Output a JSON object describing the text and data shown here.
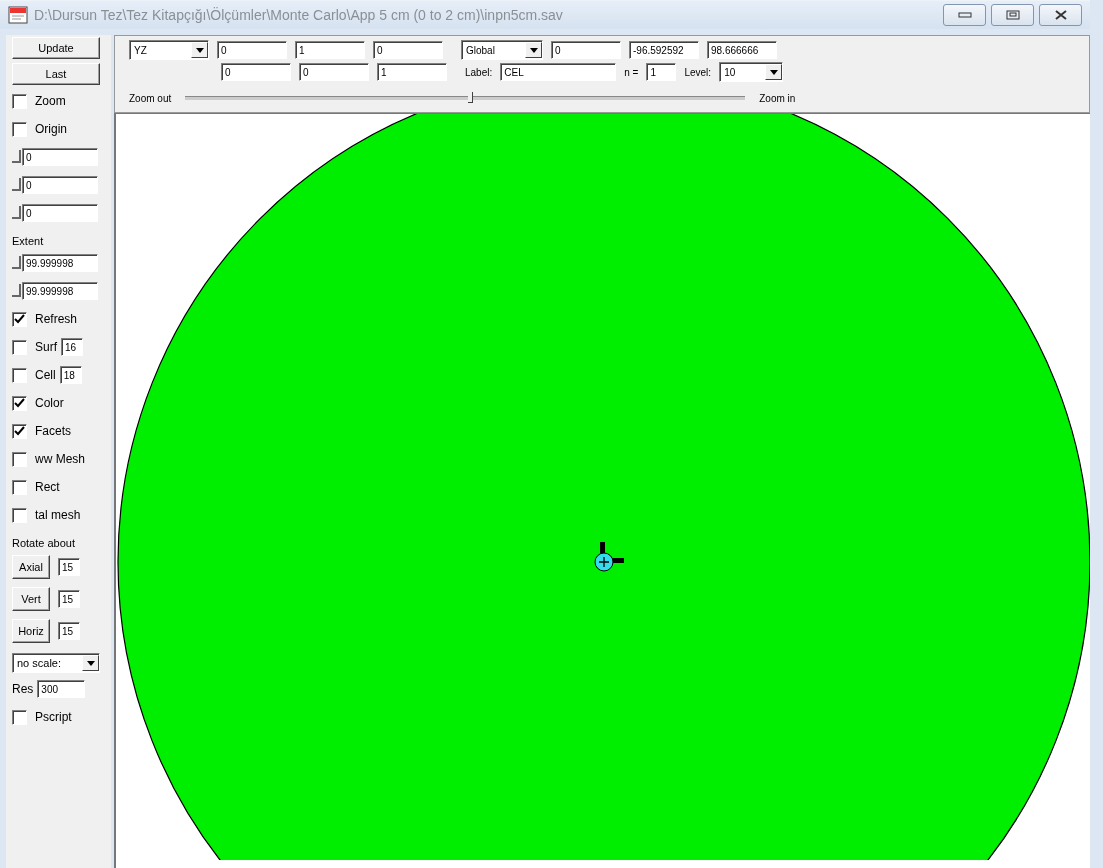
{
  "window": {
    "title": "D:\\Dursun Tez\\Tez Kitapçığı\\Ölçümler\\Monte Carlo\\App 5 cm (0 to 2 cm)\\inpn5cm.sav"
  },
  "toolbar": {
    "view_select": "YZ",
    "row1_fields": [
      "0",
      "1",
      "0"
    ],
    "row2_fields": [
      "0",
      "0",
      "1"
    ],
    "frame_select": "Global",
    "offset_fields": [
      "0",
      "-96.592592",
      "98.666666"
    ],
    "label_caption": "Label:",
    "label_value": "CEL",
    "n_caption": "n =",
    "n_value": "1",
    "level_caption": "Level:",
    "level_select": "10",
    "zoom_out": "Zoom out",
    "zoom_in": "Zoom in",
    "zoom": {
      "level": 0.505
    }
  },
  "sidebar": {
    "items": [
      {
        "kind": "button",
        "label": "Update"
      },
      {
        "kind": "button",
        "label": "Last"
      },
      {
        "kind": "checkbox",
        "label": "Zoom",
        "checked": false
      },
      {
        "kind": "checkbox",
        "label": "Origin",
        "checked": false
      },
      {
        "kind": "slider-field",
        "value": "0"
      },
      {
        "kind": "slider-field",
        "value": "0"
      },
      {
        "kind": "slider-field",
        "value": "0"
      },
      {
        "kind": "label",
        "label": "Extent"
      },
      {
        "kind": "slider-field",
        "value": "99.999998"
      },
      {
        "kind": "slider-field",
        "value": "99.999998"
      },
      {
        "kind": "checkbox",
        "label": "Refresh",
        "checked": true
      },
      {
        "kind": "checkbox-field",
        "label": "Surf",
        "checked": false,
        "value": "16"
      },
      {
        "kind": "checkbox-field",
        "label": "Cell",
        "checked": false,
        "value": "18"
      },
      {
        "kind": "checkbox",
        "label": "Color",
        "checked": true
      },
      {
        "kind": "checkbox",
        "label": "Facets",
        "checked": true
      },
      {
        "kind": "checkbox",
        "label": "ww Mesh",
        "checked": false
      },
      {
        "kind": "checkbox",
        "label": "Rect",
        "checked": false
      },
      {
        "kind": "checkbox",
        "label": "tal mesh",
        "checked": false
      },
      {
        "kind": "label",
        "label": "Rotate about"
      },
      {
        "kind": "button-field",
        "label": "Axial",
        "value": "15"
      },
      {
        "kind": "button-field",
        "label": "Vert",
        "value": "15"
      },
      {
        "kind": "button-field",
        "label": "Horiz",
        "value": "15"
      },
      {
        "kind": "select",
        "value": "no scale:"
      },
      {
        "kind": "labeled-field",
        "label": "Res",
        "value": "300"
      },
      {
        "kind": "checkbox",
        "label": "Pscript",
        "checked": false
      }
    ]
  }
}
